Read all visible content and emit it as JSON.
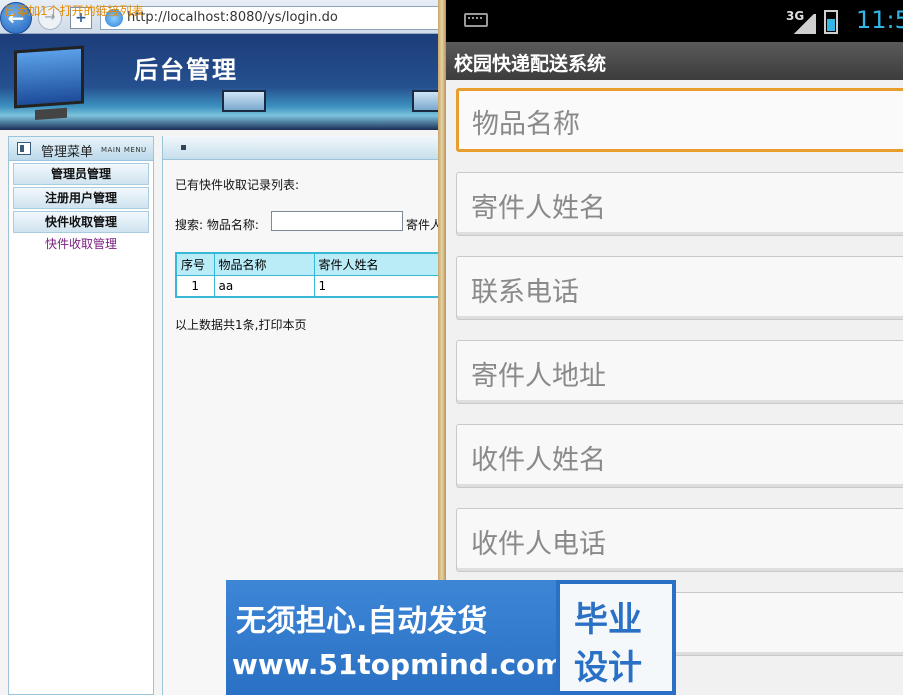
{
  "browser": {
    "notice": "已添加1个打开的链接列表",
    "url": "http://localhost:8080/ys/login.do",
    "back_icon": "back-arrow-icon"
  },
  "banner": {
    "title": "后台管理"
  },
  "sidebar": {
    "title": "管理菜单",
    "title_en": "MAIN MENU",
    "groups": [
      {
        "label": "管理员管理"
      },
      {
        "label": "注册用户管理"
      },
      {
        "label": "快件收取管理"
      }
    ],
    "sub_item": "快件收取管理"
  },
  "main": {
    "list_title": "已有快件收取记录列表:",
    "search_label": "搜索: 物品名称:",
    "search_value": "",
    "search_label2": "寄件人",
    "table": {
      "headers": [
        "序号",
        "物品名称",
        "寄件人姓名"
      ],
      "rows": [
        [
          "1",
          "aa",
          "1"
        ]
      ]
    },
    "footer": "以上数据共1条,打印本页"
  },
  "phone": {
    "status": {
      "network": "3G",
      "time": "11:5"
    },
    "app_title": "校园快递配送系统",
    "fields": [
      {
        "placeholder": "物品名称",
        "focused": true
      },
      {
        "placeholder": "寄件人姓名"
      },
      {
        "placeholder": "联系电话"
      },
      {
        "placeholder": "寄件人地址"
      },
      {
        "placeholder": "收件人姓名"
      },
      {
        "placeholder": "收件人电话"
      }
    ]
  },
  "watermark": {
    "line1": "无须担心.自动发货",
    "line2": "www.51topmind.com",
    "badge1": "毕业",
    "badge2": "设计"
  },
  "colors": {
    "focus_border": "#e99d2c",
    "table_border": "#38b8d4",
    "clock": "#33b5e5",
    "watermark_blue": "#2a70c4"
  }
}
